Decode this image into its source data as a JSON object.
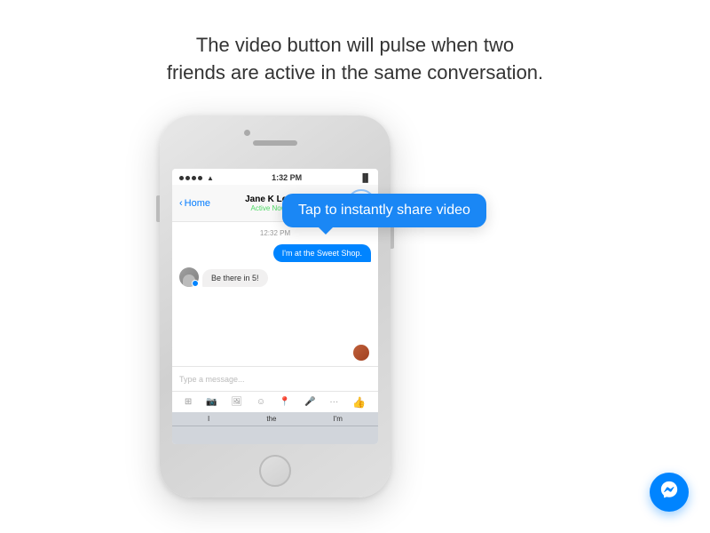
{
  "heading": {
    "line1": "The video button will pulse when two",
    "line2": "friends are active in the same conversation."
  },
  "tooltip": {
    "text": "Tap to instantly share video"
  },
  "phone": {
    "statusBar": {
      "dots": 4,
      "time": "1:32 PM"
    },
    "navBar": {
      "backLabel": "Home",
      "contactName": "Jane K Lee",
      "contactStatus": "Active Now",
      "phoneIcon": "📞",
      "videoIcon": "📹"
    },
    "chat": {
      "timestamp": "12:32 PM",
      "messages": [
        {
          "type": "outgoing",
          "text": "I'm at the Sweet Shop."
        },
        {
          "type": "incoming",
          "text": "Be there in 5!"
        }
      ]
    },
    "inputBar": {
      "placeholder": "Type a message..."
    },
    "keyboard": {
      "suggestions": [
        "I",
        "the",
        "I'm"
      ]
    }
  },
  "fab": {
    "label": "Messenger"
  }
}
